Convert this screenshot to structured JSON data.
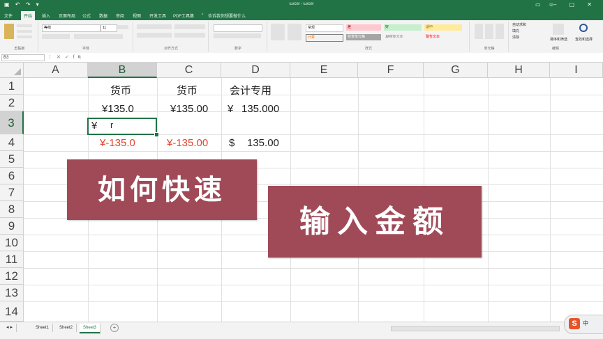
{
  "window": {
    "title": "Excel - Excel"
  },
  "ribbon": {
    "tabs": [
      {
        "label": "文件"
      },
      {
        "label": "开始"
      },
      {
        "label": "插入"
      },
      {
        "label": "页面布局"
      },
      {
        "label": "公式"
      },
      {
        "label": "数据"
      },
      {
        "label": "审阅"
      },
      {
        "label": "视图"
      },
      {
        "label": "开发工具"
      },
      {
        "label": "PDF工具集"
      },
      {
        "label": "告诉我你想要做什么"
      }
    ],
    "font_name": "等线",
    "font_size": "11",
    "groups": {
      "clipboard": "剪贴板",
      "font": "字体",
      "alignment": "对齐方式",
      "number": "数字",
      "styles": "样式",
      "cells": "单元格",
      "editing": "编辑"
    },
    "style_cells": [
      "常规",
      "差",
      "好",
      "适中",
      "计算",
      "检查单元格",
      "解释性文本",
      "警告文本"
    ],
    "editing_items": [
      "自动求和",
      "填充",
      "清除",
      "排序和筛选",
      "查找和选择"
    ]
  },
  "formula_bar": {
    "name_box": "B3",
    "fx": "fx",
    "value": "r"
  },
  "columns": [
    "A",
    "B",
    "C",
    "D",
    "E",
    "F",
    "G",
    "H",
    "I"
  ],
  "selected_column": "B",
  "rows": [
    "1",
    "2",
    "3",
    "4",
    "5",
    "6",
    "7",
    "8",
    "9",
    "10",
    "11",
    "12",
    "13",
    "14"
  ],
  "selected_row": "3",
  "cells": {
    "B1": "货币",
    "C1": "货币",
    "D1": "会计专用",
    "B2": "¥135.0",
    "C2": "¥135.00",
    "D2_sym": "¥",
    "D2_val": "135.000",
    "B3_sym": "¥",
    "B3_val": "r",
    "B4": "¥-135.0",
    "C4": "¥-135.00",
    "D4_sym": "$",
    "D4_val": "135.00"
  },
  "colors": {
    "negative": "#e0452e",
    "excel_green": "#217346",
    "banner": "#a04a58"
  },
  "banners": {
    "left": "如何快速",
    "right": "输入金额"
  },
  "sheets": {
    "tabs": [
      "Sheet1",
      "Sheet2",
      "Sheet3"
    ],
    "active": "Sheet3",
    "add_label": "+"
  },
  "ime": {
    "logo": "S",
    "mode": "中"
  }
}
